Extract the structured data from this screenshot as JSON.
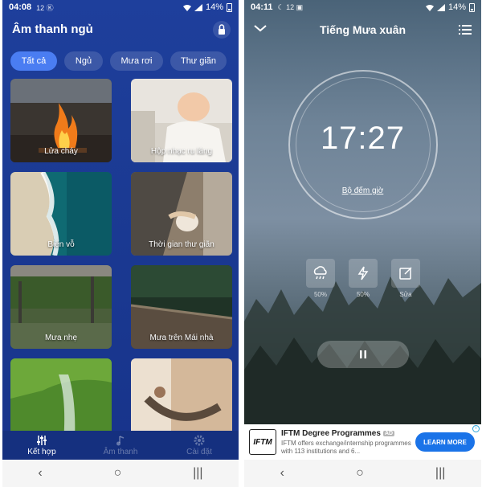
{
  "left_screen": {
    "status": {
      "time": "04:08",
      "battery": "14%",
      "icons": "12 Ⓚ"
    },
    "title": "Âm thanh ngủ",
    "chips": [
      "Tất cả",
      "Ngủ",
      "Mưa rơi",
      "Thư giãn"
    ],
    "cards": [
      {
        "label": "Lửa cháy"
      },
      {
        "label": "Hộp nhạc ru lâng"
      },
      {
        "label": "Biển vỗ"
      },
      {
        "label": "Thời gian thư giãn"
      },
      {
        "label": "Mưa nhẹ"
      },
      {
        "label": "Mưa trên Mái nhà"
      },
      {
        "label": ""
      },
      {
        "label": ""
      }
    ],
    "nav": [
      {
        "label": "Kết hợp"
      },
      {
        "label": "Âm thanh"
      },
      {
        "label": "Cài đặt"
      }
    ]
  },
  "right_screen": {
    "status": {
      "time": "04:11",
      "battery": "14%",
      "icons": "☾ 12 ▣"
    },
    "title": "Tiếng Mưa xuân",
    "clock": "17:27",
    "timer_label": "Bộ đếm giờ",
    "controls": [
      {
        "icon": "rain-cloud-icon",
        "label": "50%"
      },
      {
        "icon": "thunder-icon",
        "label": "50%"
      },
      {
        "icon": "edit-icon",
        "label": "Sửa"
      }
    ],
    "ad": {
      "logo_text": "IFTM",
      "title": "IFTM Degree Programmes",
      "badge": "AD",
      "description": "IFTM offers exchange/internship programmes with 113 institutions and 6...",
      "button": "LEARN MORE"
    }
  }
}
